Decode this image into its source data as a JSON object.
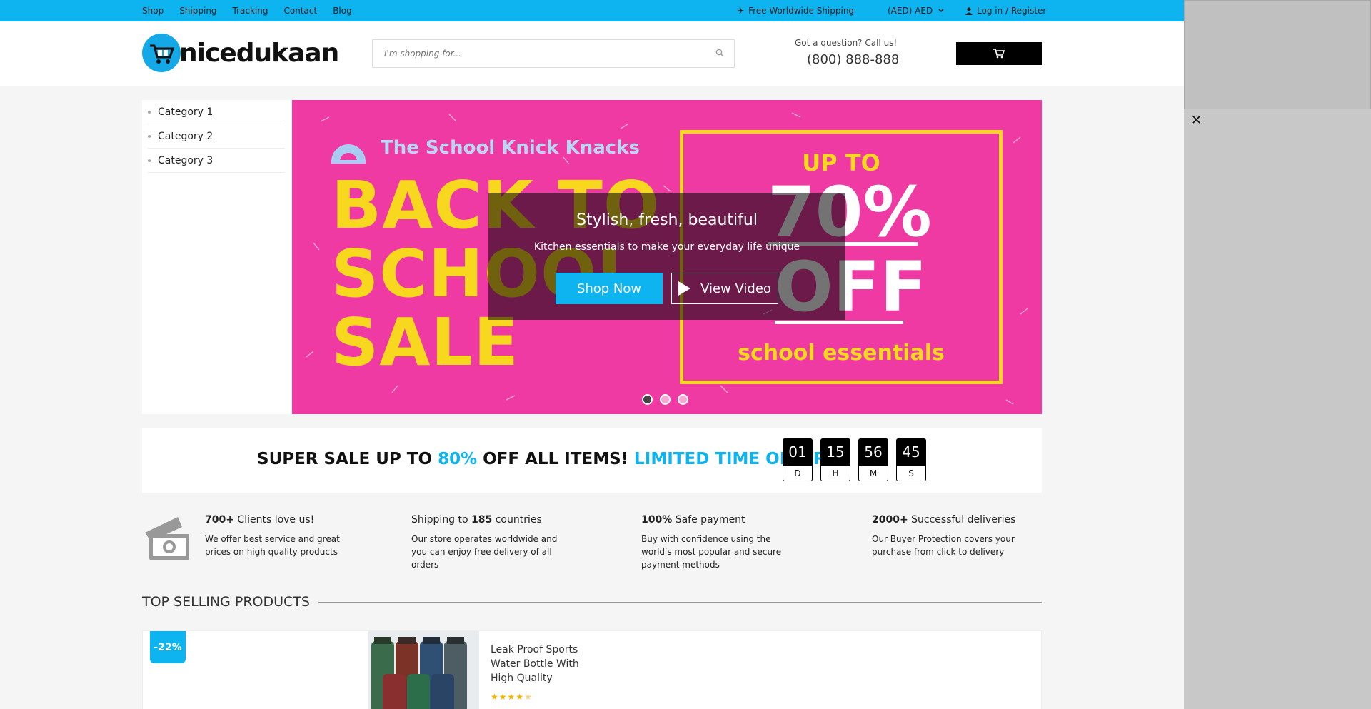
{
  "topbar": {
    "nav": [
      "Shop",
      "Shipping",
      "Tracking",
      "Contact",
      "Blog"
    ],
    "shipping": "Free Worldwide Shipping",
    "currency": "(AED) AED",
    "login": "Log in / Register"
  },
  "header": {
    "logo_text": "nicedukaan",
    "search_placeholder": "I'm shopping for...",
    "question": "Got a question? Call us!",
    "phone": "(800) 888-888"
  },
  "categories": [
    "Category 1",
    "Category 2",
    "Category 3"
  ],
  "banner": {
    "school_title": "The School Knick Knacks",
    "back_line1": "BACK TO",
    "back_line2": "SCHOOL",
    "back_line3": "SALE",
    "up_to": "UP TO",
    "percent": "70%",
    "off": "OFF",
    "essentials": "school essentials",
    "overlay_title": "Stylish, fresh, beautiful",
    "overlay_sub": "Kitchen essentials to make your everyday life unique",
    "shop_now": "Shop Now",
    "view_video": "View Video",
    "slide_count": 3,
    "active_slide": 1
  },
  "sale": {
    "part1": "SUPER SALE UP TO ",
    "part2": "80%",
    "part3": " OFF ALL ITEMS! ",
    "part4": "LIMITED TIME OFFER",
    "countdown": [
      {
        "value": "01",
        "label": "D"
      },
      {
        "value": "15",
        "label": "H"
      },
      {
        "value": "56",
        "label": "M"
      },
      {
        "value": "45",
        "label": "S"
      }
    ]
  },
  "features": [
    {
      "bold": "700+",
      "rest": " Clients love us!",
      "desc": "We offer best service and great prices on high quality products"
    },
    {
      "pre": "Shipping to ",
      "bold": "185",
      "rest": " countries",
      "desc": "Our store operates worldwide and you can enjoy free delivery of all orders"
    },
    {
      "bold": "100%",
      "rest": " Safe payment",
      "desc": "Buy with confidence using the world's most popular and secure payment methods"
    },
    {
      "bold": "2000+",
      "rest": " Successful deliveries",
      "desc": "Our Buyer Protection covers your purchase from click to delivery"
    }
  ],
  "top_selling": {
    "title": "TOP SELLING PRODUCTS",
    "badge": "-22%",
    "product_name": "Leak Proof Sports Water Bottle With High Quality",
    "rating": 4.5
  },
  "colors": {
    "accent": "#0db4ef",
    "banner_pink": "#ee3aa2",
    "banner_yellow": "#f8d71f"
  },
  "icons": [
    "plane-icon",
    "chevron-down-icon",
    "user-icon",
    "search-icon",
    "cart-icon",
    "play-icon",
    "money-icon",
    "close-icon",
    "star-icon"
  ]
}
